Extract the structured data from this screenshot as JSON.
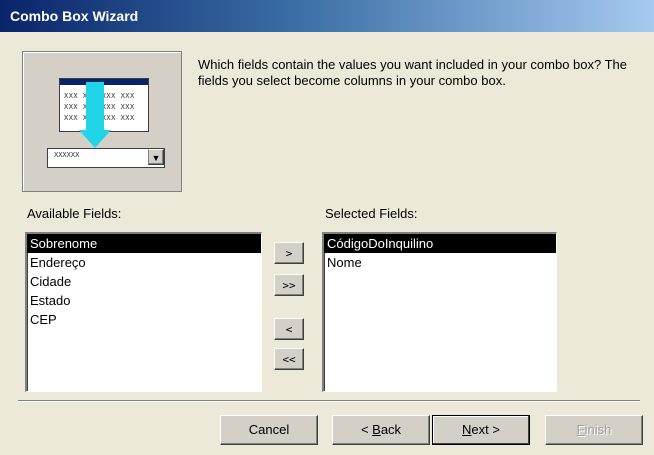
{
  "window": {
    "title": "Combo Box Wizard"
  },
  "illustration": {
    "cells_row1": "XXX XXX XXX XXX",
    "cells_row2": "XXX XXX XXX XXX",
    "cells_row3": "XXX XXX XXX XXX",
    "combo_text": "XXXXXX",
    "combo_arrow": "▼"
  },
  "instructions": "Which fields contain the values you want included in your combo box? The fields you select become columns in your combo box.",
  "available": {
    "label": "Available Fields:",
    "items": [
      "Sobrenome",
      "Endereço",
      "Cidade",
      "Estado",
      "CEP"
    ],
    "selected_index": 0
  },
  "selected": {
    "label": "Selected Fields:",
    "items": [
      "CódigoDoInquilino",
      "Nome"
    ],
    "selected_index": 0
  },
  "move_buttons": {
    "add_one": ">",
    "add_all": ">>",
    "remove_one": "<",
    "remove_all": "<<"
  },
  "footer": {
    "cancel": "Cancel",
    "back_prefix": "< ",
    "back_mnemonic": "B",
    "back_rest": "ack",
    "next_mnemonic": "N",
    "next_rest": "ext >",
    "finish_mnemonic": "F",
    "finish_rest": "inish"
  }
}
